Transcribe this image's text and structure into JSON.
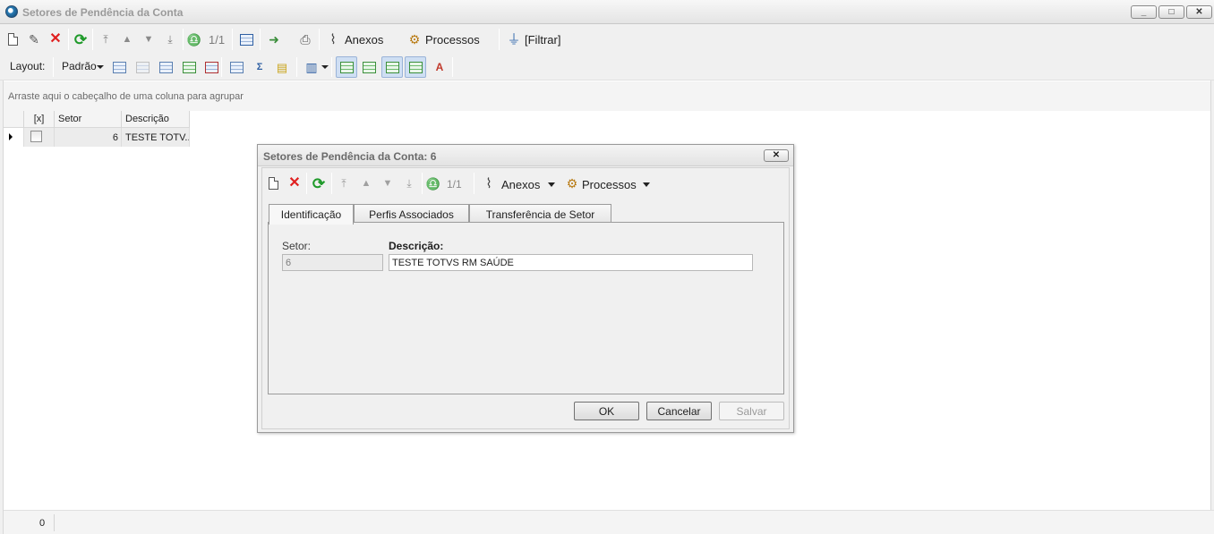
{
  "window": {
    "title": "Setores de Pendência da Conta",
    "controls": {
      "minimize": "_",
      "maximize": "□",
      "close": "✕"
    }
  },
  "toolbar": {
    "record_position": "1/1",
    "attachments_label": "Anexos",
    "processes_label": "Processos",
    "filter_label": "[Filtrar]"
  },
  "toolbar2": {
    "layout_label": "Layout:",
    "layout_value": "Padrão"
  },
  "group_panel": {
    "hint": "Arraste aqui o cabeçalho de uma coluna para agrupar"
  },
  "grid": {
    "columns": [
      "[x]",
      "Setor",
      "Descrição"
    ],
    "rows": [
      {
        "setor": "6",
        "descricao": "TESTE TOTV..."
      }
    ]
  },
  "footer": {
    "record_count": "0"
  },
  "dialog": {
    "title": "Setores de Pendência da Conta: 6",
    "record_position": "1/1",
    "attachments_label": "Anexos",
    "processes_label": "Processos",
    "tabs": [
      "Identificação",
      "Perfis Associados",
      "Transferência de Setor"
    ],
    "fields": {
      "setor_label": "Setor:",
      "setor_value": "6",
      "descricao_label": "Descrição:",
      "descricao_value": "TESTE TOTVS RM SAÚDE"
    },
    "buttons": {
      "ok": "OK",
      "cancel": "Cancelar",
      "save": "Salvar"
    }
  }
}
